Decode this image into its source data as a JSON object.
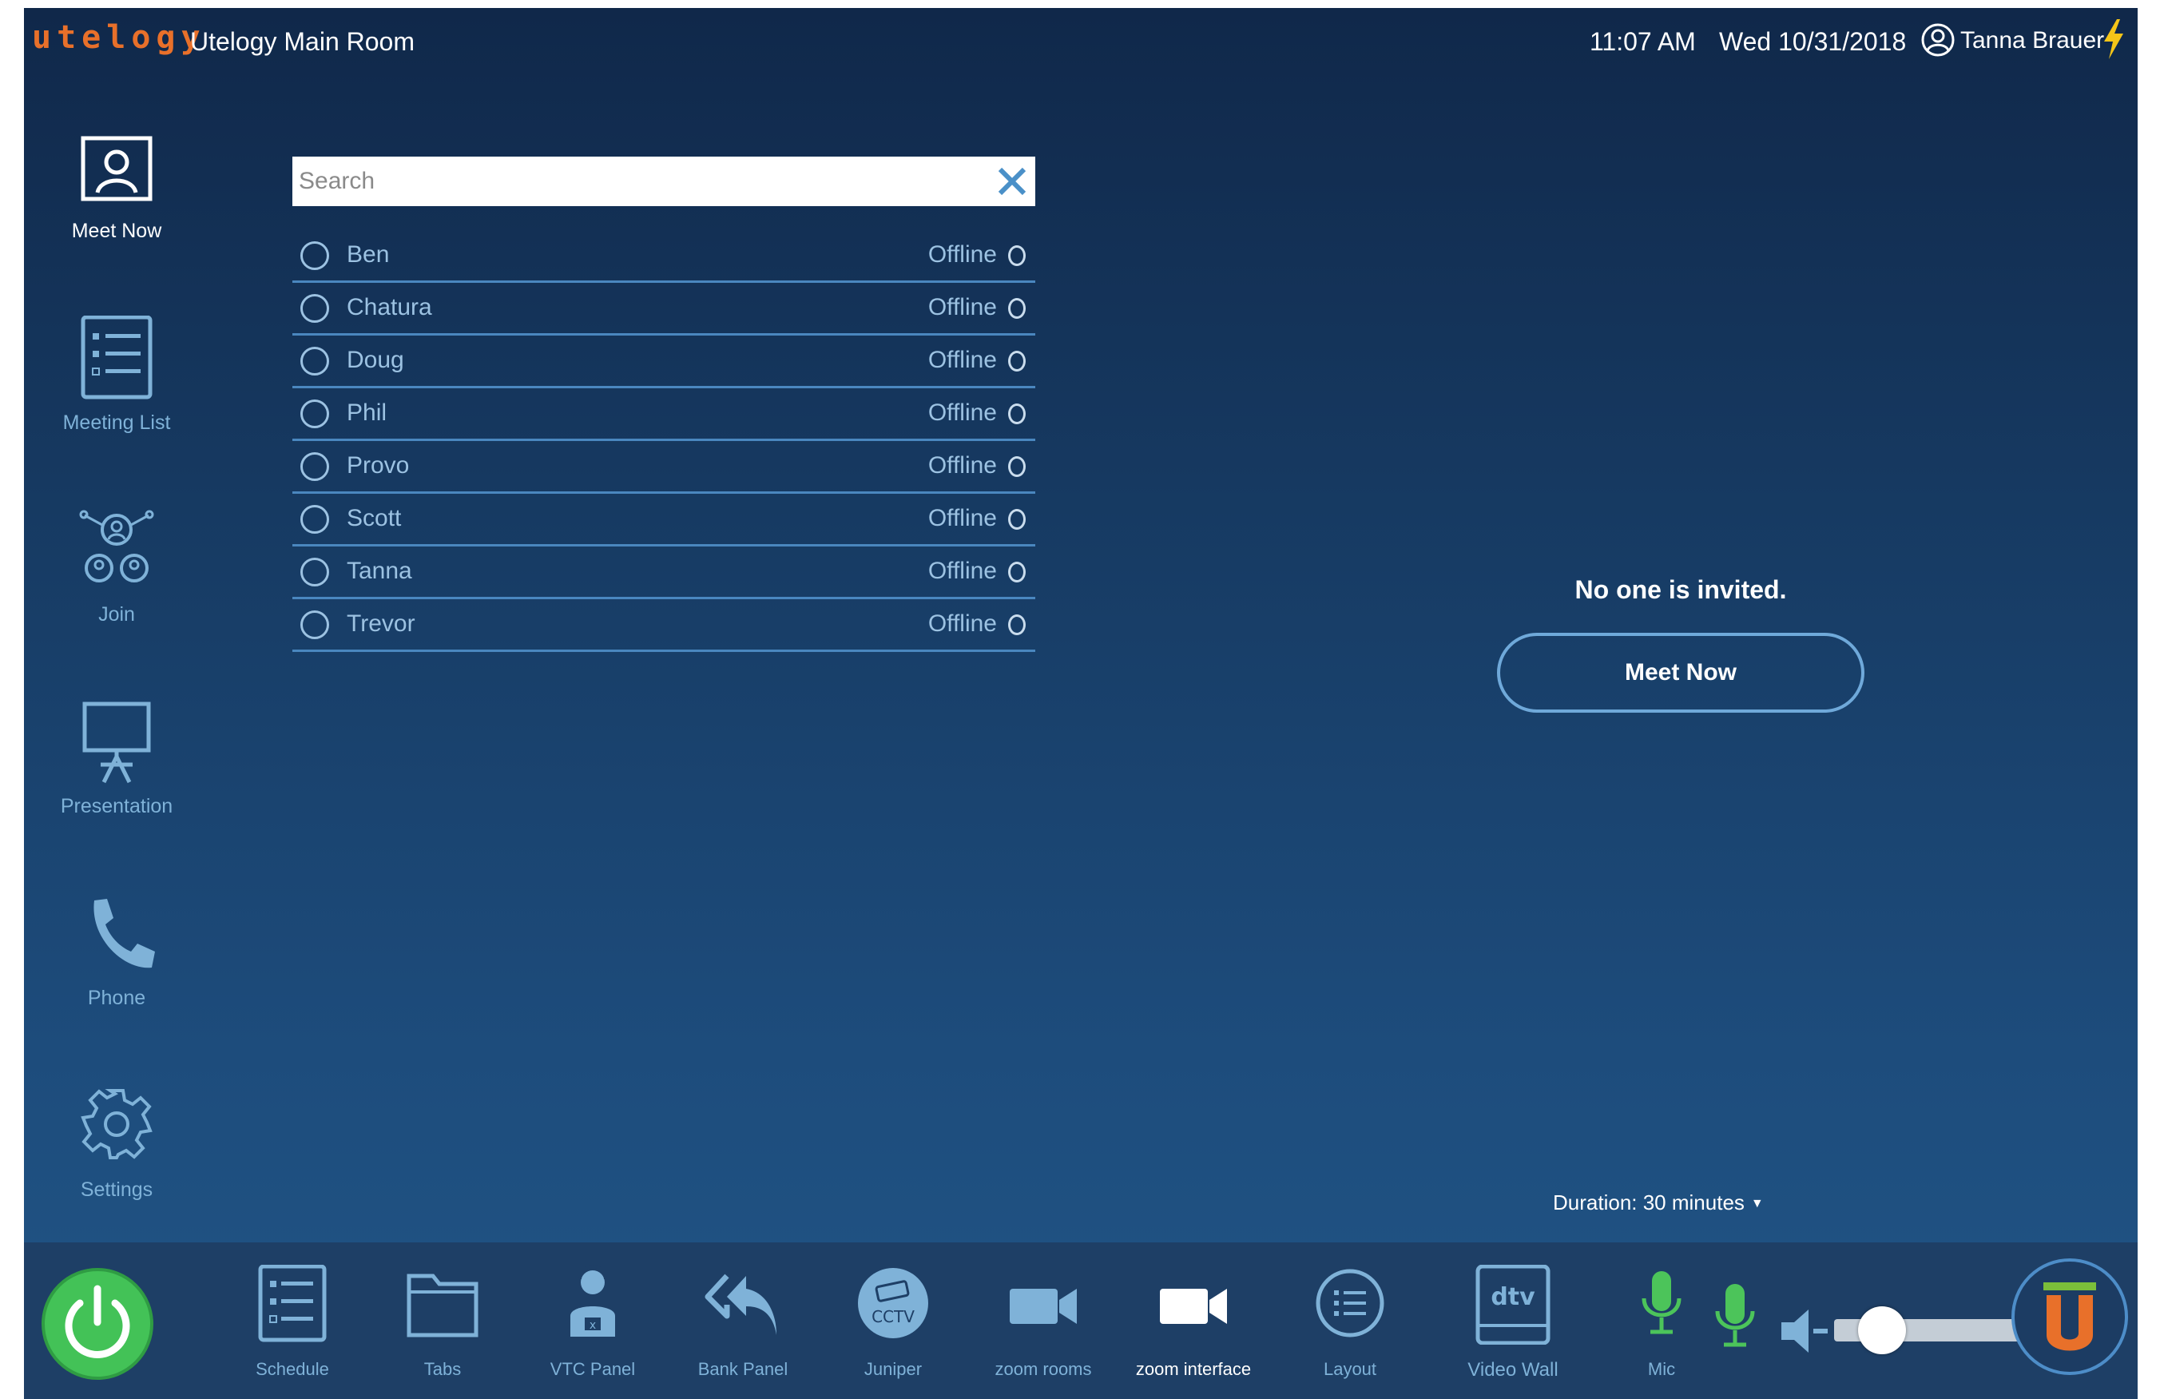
{
  "header": {
    "logo": "utelogy",
    "room_name": "Utelogy Main Room",
    "time": "11:07 AM",
    "date": "Wed 10/31/2018",
    "user": "Tanna Brauer",
    "user_icon": "user-circle-icon",
    "status_icon": "lightning-bolt-icon"
  },
  "sidebar": {
    "items": [
      {
        "label": "Meet Now",
        "icon": "meet-now-icon",
        "active": true
      },
      {
        "label": "Meeting List",
        "icon": "meeting-list-icon",
        "active": false
      },
      {
        "label": "Join",
        "icon": "join-icon",
        "active": false
      },
      {
        "label": "Presentation",
        "icon": "presentation-icon",
        "active": false
      },
      {
        "label": "Phone",
        "icon": "phone-icon",
        "active": false
      },
      {
        "label": "Settings",
        "icon": "gear-icon",
        "active": false
      }
    ]
  },
  "search": {
    "placeholder": "Search",
    "value": ""
  },
  "contacts": [
    {
      "name": "Ben",
      "status": "Offline"
    },
    {
      "name": "Chatura",
      "status": "Offline"
    },
    {
      "name": "Doug",
      "status": "Offline"
    },
    {
      "name": "Phil",
      "status": "Offline"
    },
    {
      "name": "Provo",
      "status": "Offline"
    },
    {
      "name": "Scott",
      "status": "Offline"
    },
    {
      "name": "Tanna",
      "status": "Offline"
    },
    {
      "name": "Trevor",
      "status": "Offline"
    }
  ],
  "meeting": {
    "no_invite_text": "No one is invited.",
    "meet_now_label": "Meet Now",
    "duration": "Duration: 30 minutes"
  },
  "bottom_bar": {
    "items": [
      {
        "label": "Schedule",
        "icon": "schedule-icon"
      },
      {
        "label": "Tabs",
        "icon": "folder-icon"
      },
      {
        "label": "VTC Panel",
        "icon": "operator-icon"
      },
      {
        "label": "Bank Panel",
        "icon": "reply-all-icon"
      },
      {
        "label": "Juniper",
        "icon": "cctv-camera-icon",
        "badge": "CCTV"
      },
      {
        "label": "zoom rooms",
        "icon": "video-camera-icon"
      },
      {
        "label": "zoom interface",
        "icon": "video-camera-icon",
        "active": true
      },
      {
        "label": "Layout",
        "icon": "list-circle-icon"
      },
      {
        "label": "Video Wall",
        "icon": "dtv-icon",
        "badge": "dtv"
      },
      {
        "label": "Mic",
        "icon": "microphone-icon"
      }
    ],
    "volume_level": 0.25,
    "colors": {
      "power": "#43c257",
      "mic": "#4cc45a",
      "accent": "#e8702a",
      "brand_green": "#7bbf3a"
    }
  }
}
